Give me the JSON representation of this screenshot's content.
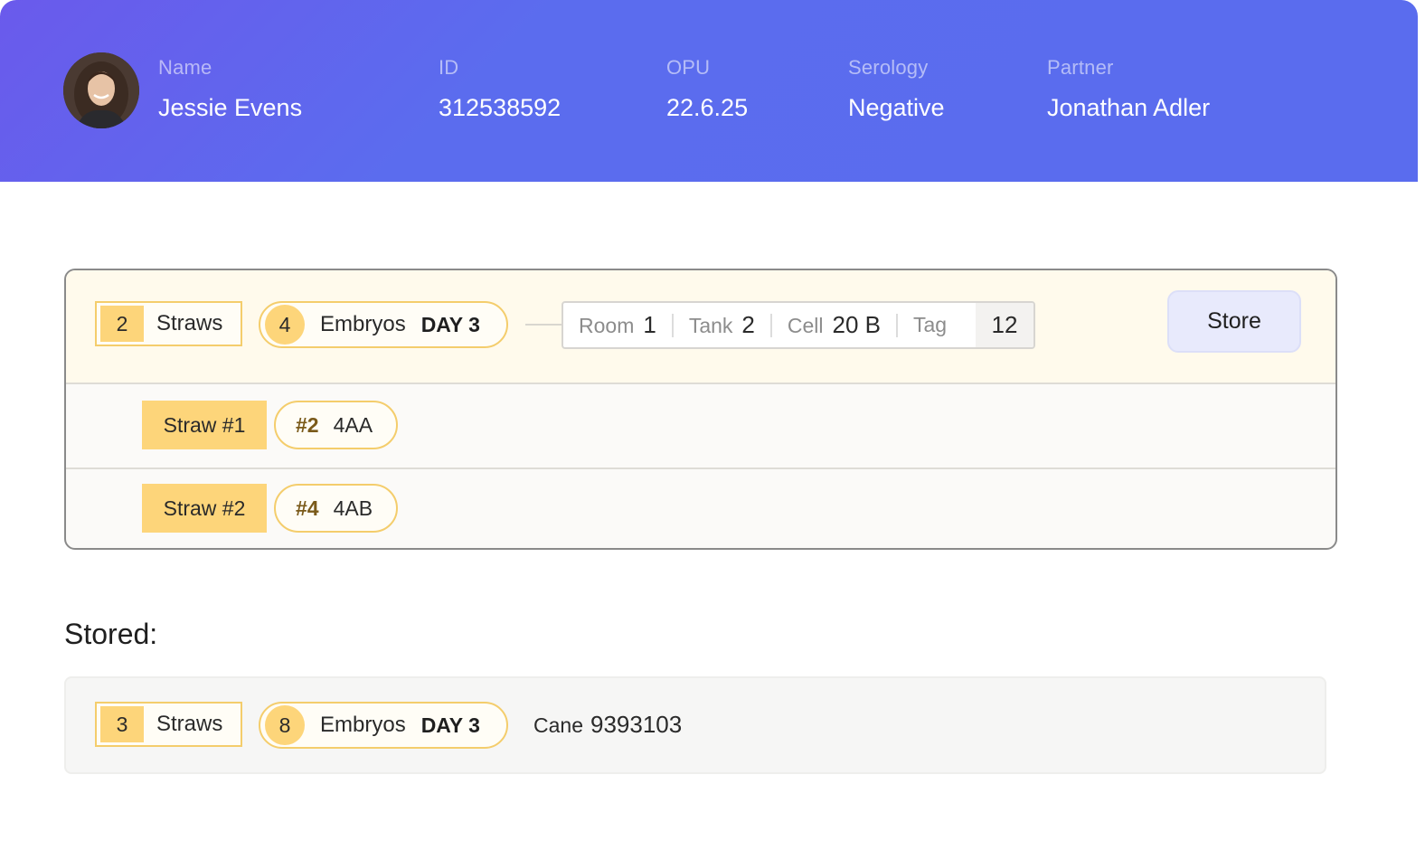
{
  "patient": {
    "name_label": "Name",
    "name": "Jessie Evens",
    "id_label": "ID",
    "id": "312538592",
    "opu_label": "OPU",
    "opu": "22.6.25",
    "serology_label": "Serology",
    "serology": "Negative",
    "partner_label": "Partner",
    "partner": "Jonathan Adler"
  },
  "pending": {
    "straws_count": "2",
    "straws_label": "Straws",
    "embryos_count": "4",
    "embryos_label": "Embryos",
    "day_label": "DAY 3",
    "location": {
      "room_label": "Room",
      "room": "1",
      "tank_label": "Tank",
      "tank": "2",
      "cell_label": "Cell",
      "cell": "20 B",
      "tag_label": "Tag",
      "tag": "12"
    },
    "store_label": "Store",
    "straws": [
      {
        "label": "Straw #1",
        "embryo_no": "#2",
        "grade": "4AA"
      },
      {
        "label": "Straw #2",
        "embryo_no": "#4",
        "grade": "4AB"
      }
    ]
  },
  "stored": {
    "title": "Stored:",
    "straws_count": "3",
    "straws_label": "Straws",
    "embryos_count": "8",
    "embryos_label": "Embryos",
    "day_label": "DAY 3",
    "cane_label": "Cane",
    "cane": "9393103"
  },
  "colors": {
    "header": "#5b6cee",
    "accent_yellow": "#fdd57a",
    "store_button": "#e8eafc"
  }
}
